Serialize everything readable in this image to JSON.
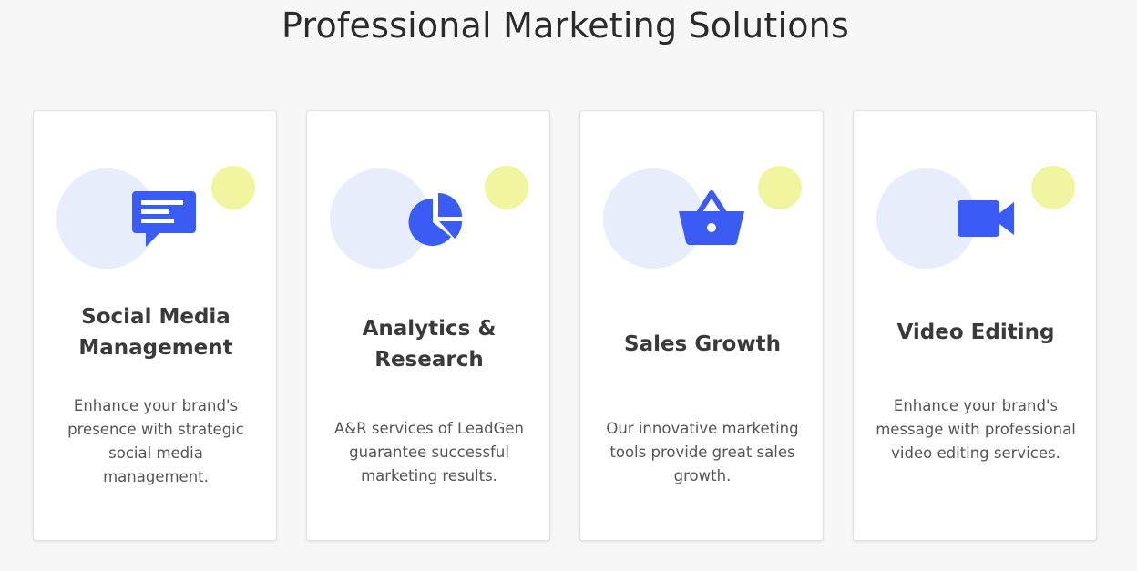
{
  "page": {
    "title": "Professional Marketing Solutions"
  },
  "colors": {
    "background": "#f7f7f7",
    "card": "#ffffff",
    "icon_blue": "#3a5cf5",
    "circle_light_blue": "#e8edfb",
    "circle_yellow": "#f1f59f"
  },
  "cards": [
    {
      "icon": "chat-message-icon",
      "title": "Social Media Management",
      "description": "Enhance your brand's presence with strategic social media management."
    },
    {
      "icon": "pie-chart-icon",
      "title": "Analytics & Research",
      "description": "A&R services of LeadGen guarantee successful marketing results."
    },
    {
      "icon": "shopping-basket-icon",
      "title": "Sales Growth",
      "description": "Our innovative marketing tools provide great sales growth."
    },
    {
      "icon": "video-camera-icon",
      "title": "Video Editing",
      "description": "Enhance your brand's message with professional video editing services."
    }
  ]
}
